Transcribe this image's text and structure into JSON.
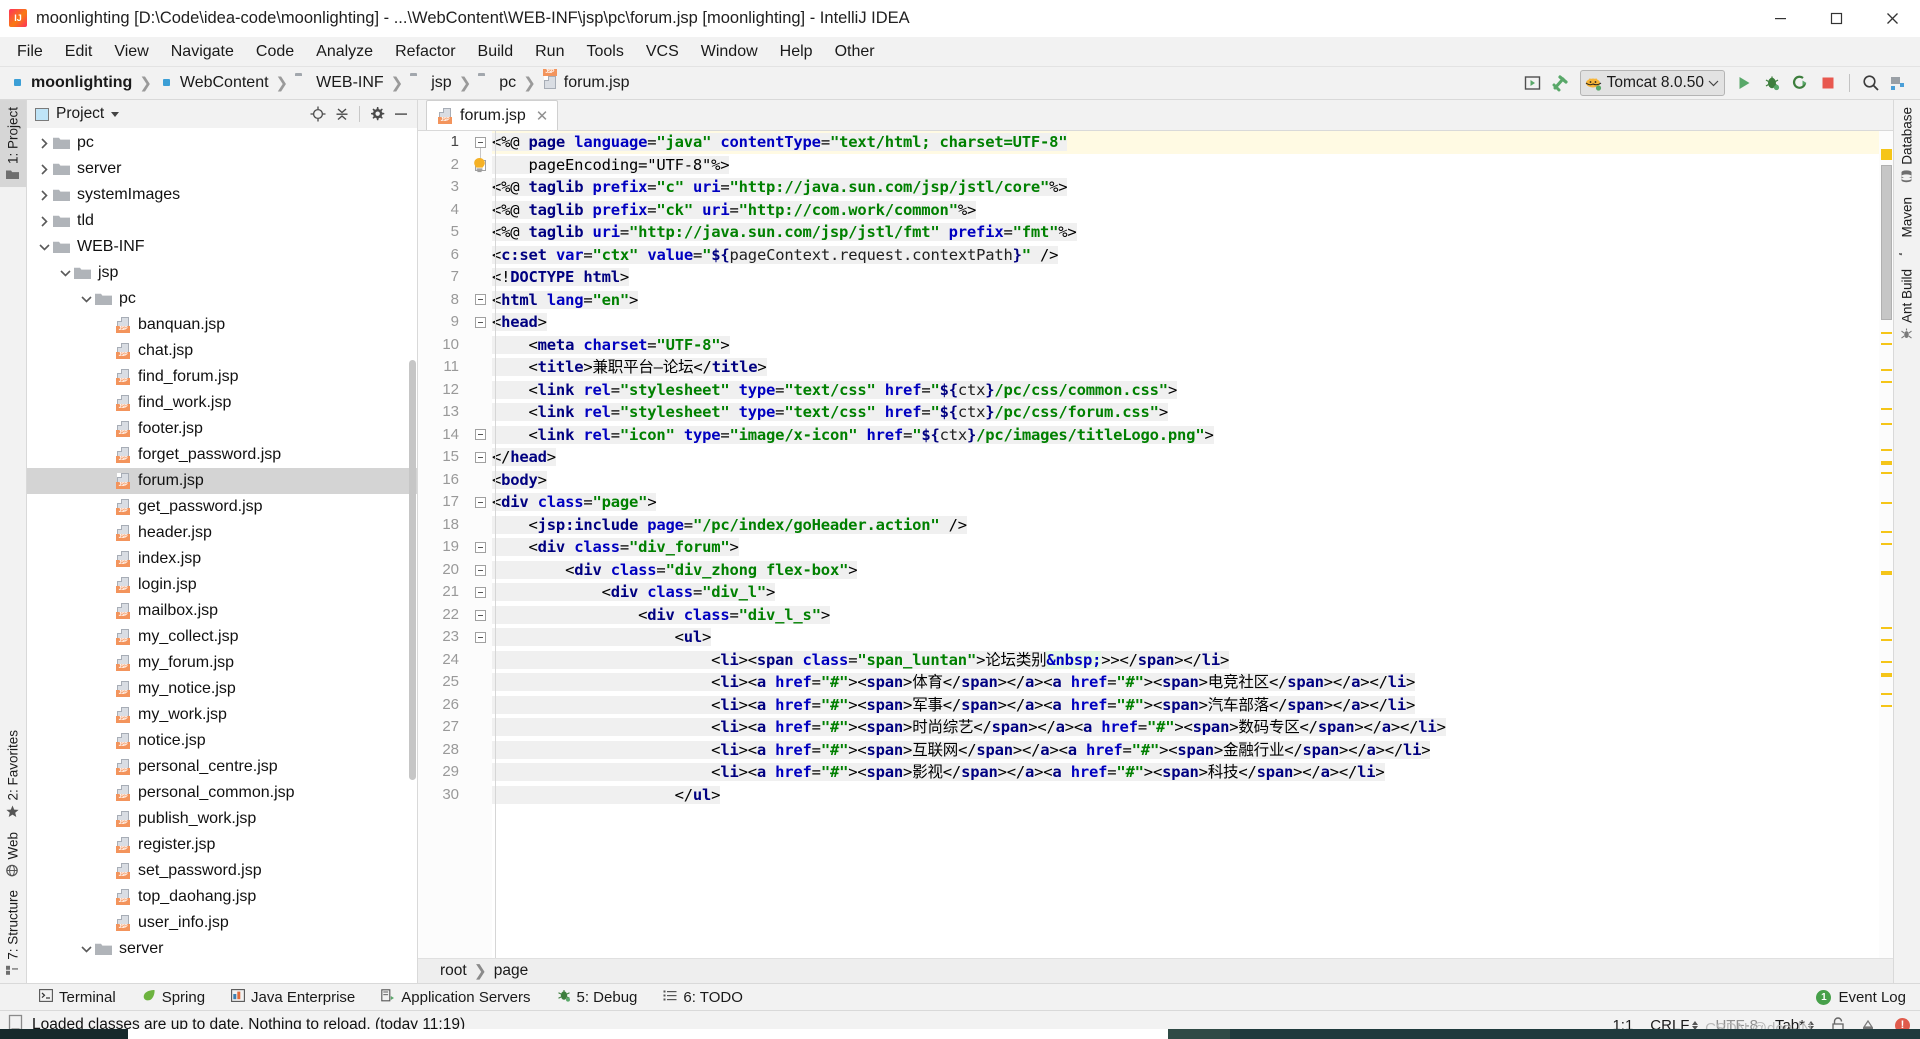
{
  "window": {
    "title": "moonlighting [D:\\Code\\idea-code\\moonlighting] - ...\\WebContent\\WEB-INF\\jsp\\pc\\forum.jsp [moonlighting] - IntelliJ IDEA",
    "minimize": "—",
    "maximize": "□",
    "close": "✕"
  },
  "menu": [
    "File",
    "Edit",
    "View",
    "Navigate",
    "Code",
    "Analyze",
    "Refactor",
    "Build",
    "Run",
    "Tools",
    "VCS",
    "Window",
    "Help",
    "Other"
  ],
  "breadcrumbs": [
    {
      "label": "moonlighting",
      "icon": "module-icon",
      "bold": true
    },
    {
      "label": "WebContent",
      "icon": "source-folder-icon",
      "bold": false
    },
    {
      "label": "WEB-INF",
      "icon": "folder-icon",
      "bold": false
    },
    {
      "label": "jsp",
      "icon": "folder-icon",
      "bold": false
    },
    {
      "label": "pc",
      "icon": "folder-icon",
      "bold": false
    },
    {
      "label": "forum.jsp",
      "icon": "jsp-file-icon",
      "bold": false
    }
  ],
  "toolbar": {
    "run_config": "Tomcat 8.0.50",
    "buttons": [
      "open-in-browser",
      "build-hammer",
      "run",
      "debug",
      "run-with-coverage",
      "stop",
      "search-everywhere",
      "project-structure"
    ]
  },
  "left_strip": {
    "top": [
      {
        "label": "1: Project",
        "active": true
      }
    ],
    "bottom": [
      {
        "label": "2: Favorites",
        "active": false
      },
      {
        "label": "Web",
        "active": false
      },
      {
        "label": "7: Structure",
        "active": false
      }
    ]
  },
  "right_strip": [
    {
      "label": "Database"
    },
    {
      "label": "Maven"
    },
    {
      "label": "Ant Build"
    }
  ],
  "project_panel": {
    "title": "Project",
    "actions": [
      "locate-icon",
      "collapse-all-icon",
      "settings-gear-icon",
      "hide-icon"
    ],
    "tree": [
      {
        "label": "pc",
        "type": "folder",
        "indent": 2,
        "state": "collapsed"
      },
      {
        "label": "server",
        "type": "folder",
        "indent": 2,
        "state": "collapsed"
      },
      {
        "label": "systemImages",
        "type": "folder",
        "indent": 2,
        "state": "collapsed"
      },
      {
        "label": "tld",
        "type": "folder",
        "indent": 2,
        "state": "collapsed"
      },
      {
        "label": "WEB-INF",
        "type": "folder",
        "indent": 2,
        "state": "expanded"
      },
      {
        "label": "jsp",
        "type": "folder",
        "indent": 3,
        "state": "expanded"
      },
      {
        "label": "pc",
        "type": "folder",
        "indent": 4,
        "state": "expanded"
      },
      {
        "label": "banquan.jsp",
        "type": "jsp",
        "indent": 5,
        "state": "leaf"
      },
      {
        "label": "chat.jsp",
        "type": "jsp",
        "indent": 5,
        "state": "leaf"
      },
      {
        "label": "find_forum.jsp",
        "type": "jsp",
        "indent": 5,
        "state": "leaf"
      },
      {
        "label": "find_work.jsp",
        "type": "jsp",
        "indent": 5,
        "state": "leaf"
      },
      {
        "label": "footer.jsp",
        "type": "jsp",
        "indent": 5,
        "state": "leaf"
      },
      {
        "label": "forget_password.jsp",
        "type": "jsp",
        "indent": 5,
        "state": "leaf"
      },
      {
        "label": "forum.jsp",
        "type": "jsp",
        "indent": 5,
        "state": "leaf",
        "selected": true
      },
      {
        "label": "get_password.jsp",
        "type": "jsp",
        "indent": 5,
        "state": "leaf"
      },
      {
        "label": "header.jsp",
        "type": "jsp",
        "indent": 5,
        "state": "leaf"
      },
      {
        "label": "index.jsp",
        "type": "jsp",
        "indent": 5,
        "state": "leaf"
      },
      {
        "label": "login.jsp",
        "type": "jsp",
        "indent": 5,
        "state": "leaf"
      },
      {
        "label": "mailbox.jsp",
        "type": "jsp",
        "indent": 5,
        "state": "leaf"
      },
      {
        "label": "my_collect.jsp",
        "type": "jsp",
        "indent": 5,
        "state": "leaf"
      },
      {
        "label": "my_forum.jsp",
        "type": "jsp",
        "indent": 5,
        "state": "leaf"
      },
      {
        "label": "my_notice.jsp",
        "type": "jsp",
        "indent": 5,
        "state": "leaf"
      },
      {
        "label": "my_work.jsp",
        "type": "jsp",
        "indent": 5,
        "state": "leaf"
      },
      {
        "label": "notice.jsp",
        "type": "jsp",
        "indent": 5,
        "state": "leaf"
      },
      {
        "label": "personal_centre.jsp",
        "type": "jsp",
        "indent": 5,
        "state": "leaf"
      },
      {
        "label": "personal_common.jsp",
        "type": "jsp",
        "indent": 5,
        "state": "leaf"
      },
      {
        "label": "publish_work.jsp",
        "type": "jsp",
        "indent": 5,
        "state": "leaf"
      },
      {
        "label": "register.jsp",
        "type": "jsp",
        "indent": 5,
        "state": "leaf"
      },
      {
        "label": "set_password.jsp",
        "type": "jsp",
        "indent": 5,
        "state": "leaf"
      },
      {
        "label": "top_daohang.jsp",
        "type": "jsp",
        "indent": 5,
        "state": "leaf"
      },
      {
        "label": "user_info.jsp",
        "type": "jsp",
        "indent": 5,
        "state": "leaf"
      },
      {
        "label": "server",
        "type": "folder",
        "indent": 4,
        "state": "expanded"
      }
    ]
  },
  "editor": {
    "tab": {
      "label": "forum.jsp",
      "close": "✕"
    },
    "breadcrumb": [
      "root",
      "page"
    ],
    "first_line": 1,
    "lines": [
      1,
      2,
      3,
      4,
      5,
      6,
      7,
      8,
      9,
      10,
      11,
      12,
      13,
      14,
      15,
      16,
      17,
      18,
      19,
      20,
      21,
      22,
      23,
      24,
      25,
      26,
      27,
      28,
      29,
      30
    ],
    "code": [
      "<%@ page language=\"java\" contentType=\"text/html; charset=UTF-8\"",
      "    pageEncoding=\"UTF-8\"%>",
      "<%@ taglib prefix=\"c\" uri=\"http://java.sun.com/jsp/jstl/core\"%>",
      "<%@ taglib prefix=\"ck\" uri=\"http://com.work/common\"%>",
      "<%@ taglib uri=\"http://java.sun.com/jsp/jstl/fmt\" prefix=\"fmt\"%>",
      "<c:set var=\"ctx\" value=\"${pageContext.request.contextPath}\" />",
      "<!DOCTYPE html>",
      "<html lang=\"en\">",
      "<head>",
      "    <meta charset=\"UTF-8\">",
      "    <title>兼职平台—论坛</title>",
      "    <link rel=\"stylesheet\" type=\"text/css\" href=\"${ctx}/pc/css/common.css\">",
      "    <link rel=\"stylesheet\" type=\"text/css\" href=\"${ctx}/pc/css/forum.css\">",
      "    <link rel=\"icon\" type=\"image/x-icon\" href=\"${ctx}/pc/images/titleLogo.png\">",
      "</head>",
      "<body>",
      "<div class=\"page\">",
      "    <jsp:include page=\"/pc/index/goHeader.action\" />",
      "    <div class=\"div_forum\">",
      "        <div class=\"div_zhong flex-box\">",
      "            <div class=\"div_l\">",
      "                <div class=\"div_l_s\">",
      "                    <ul>",
      "                        <li><span class=\"span_luntan\">论坛类别&nbsp;>></span></li>",
      "                        <li><a href=\"#\"><span>体育</span></a><a href=\"#\"><span>电竞社区</span></a></li>",
      "                        <li><a href=\"#\"><span>军事</span></a><a href=\"#\"><span>汽车部落</span></a></li>",
      "                        <li><a href=\"#\"><span>时尚综艺</span></a><a href=\"#\"><span>数码专区</span></a></li>",
      "                        <li><a href=\"#\"><span>互联网</span></a><a href=\"#\"><span>金融行业</span></a></li>",
      "                        <li><a href=\"#\"><span>影视</span></a><a href=\"#\"><span>科技</span></a></li>",
      "                    </ul>"
    ]
  },
  "bottom_bar": {
    "items": [
      {
        "label": "Terminal",
        "icon": "terminal-icon"
      },
      {
        "label": "Spring",
        "icon": "spring-leaf-icon"
      },
      {
        "label": "Java Enterprise",
        "icon": "java-enterprise-icon"
      },
      {
        "label": "Application Servers",
        "icon": "app-servers-icon"
      },
      {
        "label": "5: Debug",
        "icon": "debug-bug-icon"
      },
      {
        "label": "6: TODO",
        "icon": "todo-list-icon"
      }
    ],
    "event_log": {
      "label": "Event Log",
      "count": "1"
    }
  },
  "status_bar": {
    "message": "Loaded classes are up to date. Nothing to reload. (today 11:19)",
    "caret": "1:1",
    "line_separator": "CRLF",
    "encoding": "UTF-8",
    "indent": "Tab*",
    "watermark": "CSDN @dog-IN"
  }
}
